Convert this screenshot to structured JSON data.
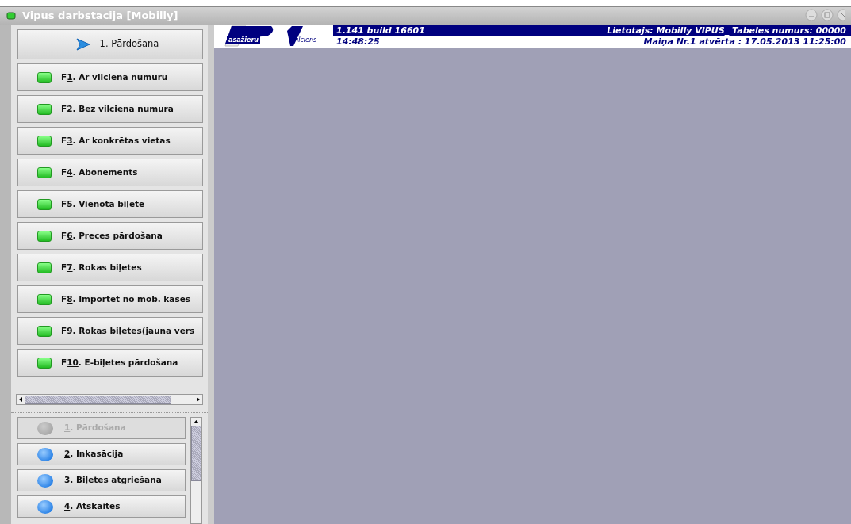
{
  "window": {
    "title": "Vipus darbstacija [Mobilly]"
  },
  "section_header": {
    "label": "1. Pārdošana"
  },
  "actions": [
    {
      "pre": "F",
      "key": "1",
      "rest": ". Ar vilciena numuru"
    },
    {
      "pre": "F",
      "key": "2",
      "rest": ". Bez vilciena numura"
    },
    {
      "pre": "F",
      "key": "3",
      "rest": ". Ar konkrētas vietas"
    },
    {
      "pre": "F",
      "key": "4",
      "rest": ". Abonements"
    },
    {
      "pre": "F",
      "key": "5",
      "rest": ". Vienotā biļete"
    },
    {
      "pre": "F",
      "key": "6",
      "rest": ". Preces pārdošana"
    },
    {
      "pre": "F",
      "key": "7",
      "rest": ". Rokas biļetes"
    },
    {
      "pre": "F",
      "key": "8",
      "rest": ". Importēt no mob. kases"
    },
    {
      "pre": "F",
      "key": "9",
      "rest": ". Rokas biļetes(jauna vers"
    },
    {
      "pre": "F",
      "key": "10",
      "rest": ". E-biļetes pārdošana"
    }
  ],
  "sections": [
    {
      "key": "1",
      "rest": ". Pārdošana",
      "disabled": true
    },
    {
      "key": "2",
      "rest": ". Inkasācija",
      "disabled": false
    },
    {
      "key": "3",
      "rest": ". Biļetes atgriešana",
      "disabled": false
    },
    {
      "key": "4",
      "rest": ". Atskaites",
      "disabled": false
    }
  ],
  "banner": {
    "logo_top": "asažieru",
    "logo_bottom": "ilciens",
    "version": "1.141  build 16601",
    "time": "14:48:25",
    "user": "Lietotajs: Mobilly VIPUS_ Tabeles numurs: 00000",
    "shift": "Maiņa Nr.1 atvērta : 17.05.2013 11:25:00"
  }
}
